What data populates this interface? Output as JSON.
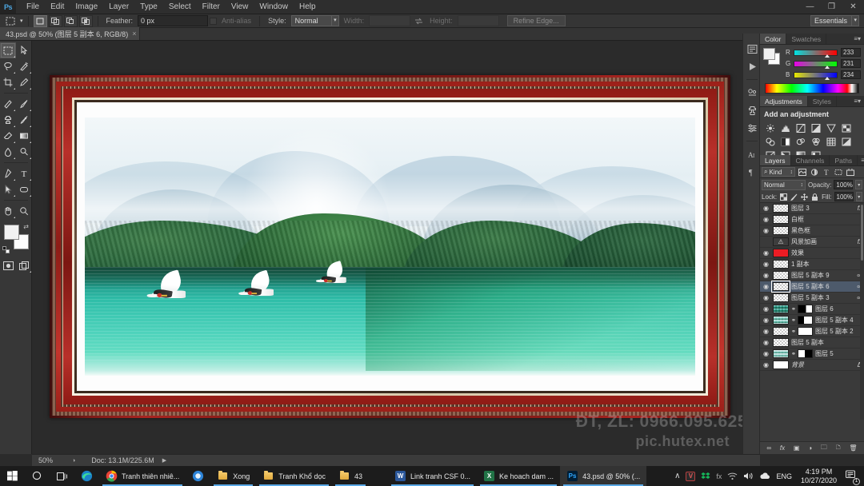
{
  "app": {
    "name": "Adobe Photoshop",
    "logo_text": "Ps"
  },
  "menubar": {
    "items": [
      "File",
      "Edit",
      "Image",
      "Layer",
      "Type",
      "Select",
      "Filter",
      "View",
      "Window",
      "Help"
    ]
  },
  "window_controls": {
    "minimize": "—",
    "restore": "❐",
    "close": "✕"
  },
  "options_bar": {
    "feather_label": "Feather:",
    "feather_value": "0 px",
    "antialias_label": "Anti-alias",
    "style_label": "Style:",
    "style_value": "Normal",
    "width_label": "Width:",
    "width_value": "",
    "height_label": "Height:",
    "height_value": "",
    "refine_edge_label": "Refine Edge...",
    "workspace": "Essentials"
  },
  "document_tab": {
    "title": "43.psd @ 50% (图层 5 副本 6, RGB/8)",
    "close_glyph": "×"
  },
  "toolbar": {
    "tools": [
      [
        "marquee-tool",
        "move-tool"
      ],
      [
        "lasso-tool",
        "quick-selection-tool"
      ],
      [
        "crop-tool",
        "eyedropper-tool"
      ],
      [
        "spot-healing-tool",
        "brush-tool"
      ],
      [
        "clone-stamp-tool",
        "history-brush-tool"
      ],
      [
        "eraser-tool",
        "gradient-tool"
      ],
      [
        "blur-tool",
        "dodge-tool"
      ],
      [
        "pen-tool",
        "type-tool"
      ],
      [
        "path-selection-tool",
        "shape-tool"
      ],
      [
        "hand-tool",
        "zoom-tool"
      ]
    ]
  },
  "status_bar": {
    "zoom": "50%",
    "doc_info": "Doc: 13.1M/225.6M"
  },
  "panels": {
    "color": {
      "tabs": [
        "Color",
        "Swatches"
      ],
      "active_tab": "Color",
      "channels": [
        {
          "label": "R",
          "value": "233"
        },
        {
          "label": "G",
          "value": "231"
        },
        {
          "label": "B",
          "value": "234"
        }
      ],
      "foreground_color": "#f2f2f2",
      "background_color": "#ffffff"
    },
    "adjustments": {
      "tabs": [
        "Adjustments",
        "Styles"
      ],
      "active_tab": "Adjustments",
      "title": "Add an adjustment",
      "icons": [
        "brightness-contrast-icon",
        "levels-icon",
        "curves-icon",
        "exposure-icon",
        "vibrance-icon",
        "hue-saturation-icon",
        "color-balance-icon",
        "black-white-icon",
        "photo-filter-icon",
        "channel-mixer-icon",
        "color-lookup-icon",
        "invert-icon",
        "posterize-icon",
        "threshold-icon",
        "gradient-map-icon",
        "selective-color-icon"
      ]
    },
    "layers": {
      "tabs": [
        "Layers",
        "Channels",
        "Paths"
      ],
      "active_tab": "Layers",
      "filter_kind": "Kind",
      "filter_icons": [
        "pixel-filter-icon",
        "adjustment-filter-icon",
        "type-filter-icon",
        "shape-filter-icon",
        "smart-object-filter-icon"
      ],
      "blend_mode": "Normal",
      "opacity_label": "Opacity:",
      "opacity_value": "100%",
      "lock_label": "Lock:",
      "lock_icons": [
        "lock-transparency-icon",
        "lock-image-icon",
        "lock-position-icon",
        "lock-all-icon"
      ],
      "fill_label": "Fill:",
      "fill_value": "100%",
      "items": [
        {
          "name": "图层 3",
          "visible": true,
          "thumb": "transparent",
          "fx": true,
          "selected": false,
          "linked": false,
          "mask": null
        },
        {
          "name": "白框",
          "visible": true,
          "thumb": "transparent",
          "fx": false,
          "selected": false,
          "linked": false,
          "mask": null
        },
        {
          "name": "黑色框",
          "visible": true,
          "thumb": "transparent",
          "fx": false,
          "selected": false,
          "linked": false,
          "mask": null
        },
        {
          "name": "风景加画",
          "visible": false,
          "thumb": "warning",
          "fx": true,
          "selected": false,
          "linked": false,
          "mask": null
        },
        {
          "name": "效果",
          "visible": true,
          "thumb": "red",
          "fx": false,
          "selected": false,
          "linked": false,
          "mask": null
        },
        {
          "name": "1 副本",
          "visible": true,
          "thumb": "transparent",
          "fx": false,
          "selected": false,
          "linked": false,
          "mask": null
        },
        {
          "name": "图层 5 副本 9",
          "visible": true,
          "thumb": "transparent",
          "fx": false,
          "selected": false,
          "linked": true,
          "mask": null
        },
        {
          "name": "图层 5 副本 6",
          "visible": true,
          "thumb": "transparent",
          "fx": false,
          "selected": true,
          "linked": true,
          "mask": null
        },
        {
          "name": "图层 5 副本 3",
          "visible": true,
          "thumb": "transparent",
          "fx": false,
          "selected": false,
          "linked": true,
          "mask": null
        },
        {
          "name": "图层 6",
          "visible": true,
          "thumb": "scene1",
          "fx": false,
          "selected": false,
          "linked": false,
          "mask": "bw1"
        },
        {
          "name": "图层 5 副本 4",
          "visible": true,
          "thumb": "scene2",
          "fx": false,
          "selected": false,
          "linked": false,
          "mask": "bw2"
        },
        {
          "name": "图层 5 副本 2",
          "visible": true,
          "thumb": "transparent",
          "fx": false,
          "selected": false,
          "linked": false,
          "mask": "w"
        },
        {
          "name": "图层 5 副本",
          "visible": true,
          "thumb": "transparent",
          "fx": false,
          "selected": false,
          "linked": false,
          "mask": null
        },
        {
          "name": "图层 5",
          "visible": true,
          "thumb": "scene4",
          "fx": false,
          "selected": false,
          "linked": false,
          "mask": "bw3"
        },
        {
          "name": "背景",
          "visible": true,
          "thumb": "white",
          "fx": false,
          "selected": false,
          "linked": false,
          "mask": null,
          "locked": true
        }
      ],
      "bottom_icons": [
        "link-layers-icon",
        "add-style-icon",
        "add-mask-icon",
        "new-adjustment-icon",
        "new-group-icon",
        "new-layer-icon",
        "delete-layer-icon"
      ]
    },
    "rail_icons": [
      "history-icon",
      "actions-icon",
      "brush-presets-icon",
      "clone-source-icon",
      "properties-icon",
      "character-icon",
      "paragraph-icon"
    ]
  },
  "canvas": {
    "watermark_phone": "ĐT, ZL: 0966.095.625",
    "watermark_site": "pic.hutex.net",
    "artwork_description": "Framed landscape: misty mountains, forested lakeshore, three white cranes over turquoise water"
  },
  "taskbar": {
    "start_label": "start-button",
    "search_label": "search-button",
    "taskview_label": "task-view-button",
    "items": [
      {
        "label": "",
        "icon": "edge-icon",
        "running": false
      },
      {
        "label": "Tranh thiên nhiê...",
        "icon": "chrome-icon",
        "running": true
      },
      {
        "label": "",
        "icon": "browser-icon",
        "running": false
      },
      {
        "label": "Xong",
        "icon": "folder-icon",
        "running": true
      },
      {
        "label": "Tranh Khổ dọc",
        "icon": "folder-icon",
        "running": true
      },
      {
        "label": "43",
        "icon": "folder-icon",
        "running": true
      },
      {
        "label": "Link tranh CSF 0...",
        "icon": "word-icon",
        "running": true
      },
      {
        "label": "Ke hoach dam ...",
        "icon": "excel-icon",
        "running": true
      },
      {
        "label": "43.psd @ 50% (...",
        "icon": "photoshop-icon",
        "running": true,
        "active": true
      }
    ],
    "tray": {
      "chevron": "∧",
      "icons": [
        "unikey-icon",
        "dropbox-icon",
        "fx-icon",
        "wifi-icon",
        "volume-icon",
        "onedrive-icon"
      ],
      "language": "ENG",
      "time": "4:19 PM",
      "date": "10/27/2020",
      "notification_count": "1"
    }
  }
}
